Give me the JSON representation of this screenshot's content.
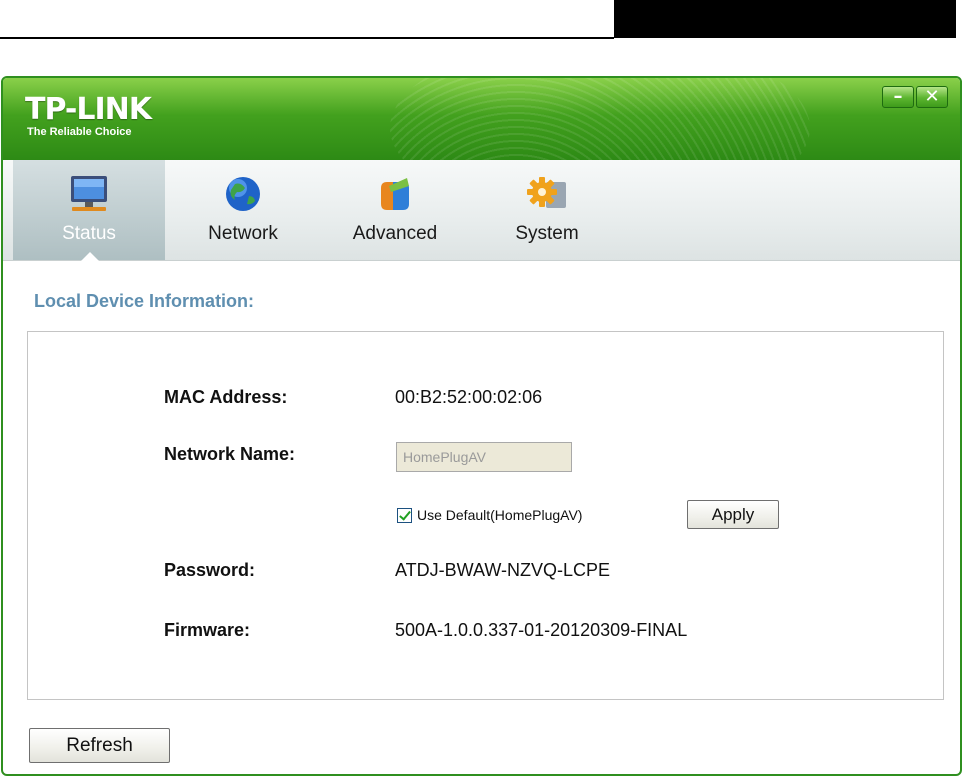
{
  "app": {
    "logo_text": "TP-LINK",
    "logo_tagline": "The Reliable Choice",
    "window_controls": {
      "minimize_icon": "minimize-icon",
      "close_icon": "close-icon"
    }
  },
  "nav": {
    "items": [
      {
        "label": "Status",
        "icon": "monitor-icon",
        "active": true
      },
      {
        "label": "Network",
        "icon": "globe-icon",
        "active": false
      },
      {
        "label": "Advanced",
        "icon": "advanced-icon",
        "active": false
      },
      {
        "label": "System",
        "icon": "gear-icon",
        "active": false
      }
    ]
  },
  "main": {
    "section_title": "Local Device Information:",
    "mac_label": "MAC  Address:",
    "mac_value": "00:B2:52:00:02:06",
    "network_name_label": "Network Name:",
    "network_name_value": "HomePlugAV",
    "use_default_label": "Use Default(HomePlugAV)",
    "use_default_checked": true,
    "apply_label": "Apply",
    "password_label": "Password:",
    "password_value": "ATDJ-BWAW-NZVQ-LCPE",
    "firmware_label": "Firmware:",
    "firmware_value": "500A-1.0.0.337-01-20120309-FINAL"
  },
  "footer": {
    "refresh_label": "Refresh"
  },
  "colors": {
    "brand_green": "#43a11e",
    "section_title_blue": "#5f8fb0",
    "active_tab": "#aebfc2"
  }
}
